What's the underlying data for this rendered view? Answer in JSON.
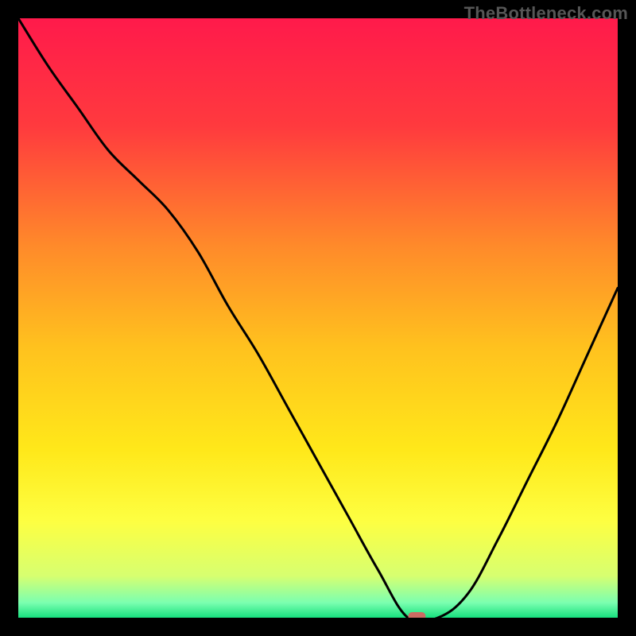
{
  "watermark": "TheBottleneck.com",
  "chart_data": {
    "type": "line",
    "title": "",
    "xlabel": "",
    "ylabel": "",
    "categories": [
      0.0,
      0.05,
      0.1,
      0.15,
      0.2,
      0.25,
      0.3,
      0.35,
      0.4,
      0.45,
      0.5,
      0.55,
      0.6,
      0.65,
      0.7,
      0.75,
      0.8,
      0.85,
      0.9,
      0.95,
      1.0
    ],
    "values": [
      1.0,
      0.92,
      0.85,
      0.78,
      0.73,
      0.68,
      0.61,
      0.52,
      0.44,
      0.35,
      0.26,
      0.17,
      0.08,
      0.0,
      0.0,
      0.04,
      0.13,
      0.23,
      0.33,
      0.44,
      0.55
    ],
    "xlim": [
      0,
      1
    ],
    "ylim": [
      0,
      1
    ],
    "marker": {
      "x": 0.665,
      "y": 0.0
    },
    "background_gradient": {
      "stops": [
        {
          "offset": 0.0,
          "color": "#ff1a4b"
        },
        {
          "offset": 0.18,
          "color": "#ff3a3e"
        },
        {
          "offset": 0.38,
          "color": "#ff8a2a"
        },
        {
          "offset": 0.55,
          "color": "#ffc21e"
        },
        {
          "offset": 0.72,
          "color": "#ffe81a"
        },
        {
          "offset": 0.84,
          "color": "#fdff42"
        },
        {
          "offset": 0.93,
          "color": "#d7ff70"
        },
        {
          "offset": 0.975,
          "color": "#7bffb0"
        },
        {
          "offset": 1.0,
          "color": "#17e07e"
        }
      ]
    }
  }
}
